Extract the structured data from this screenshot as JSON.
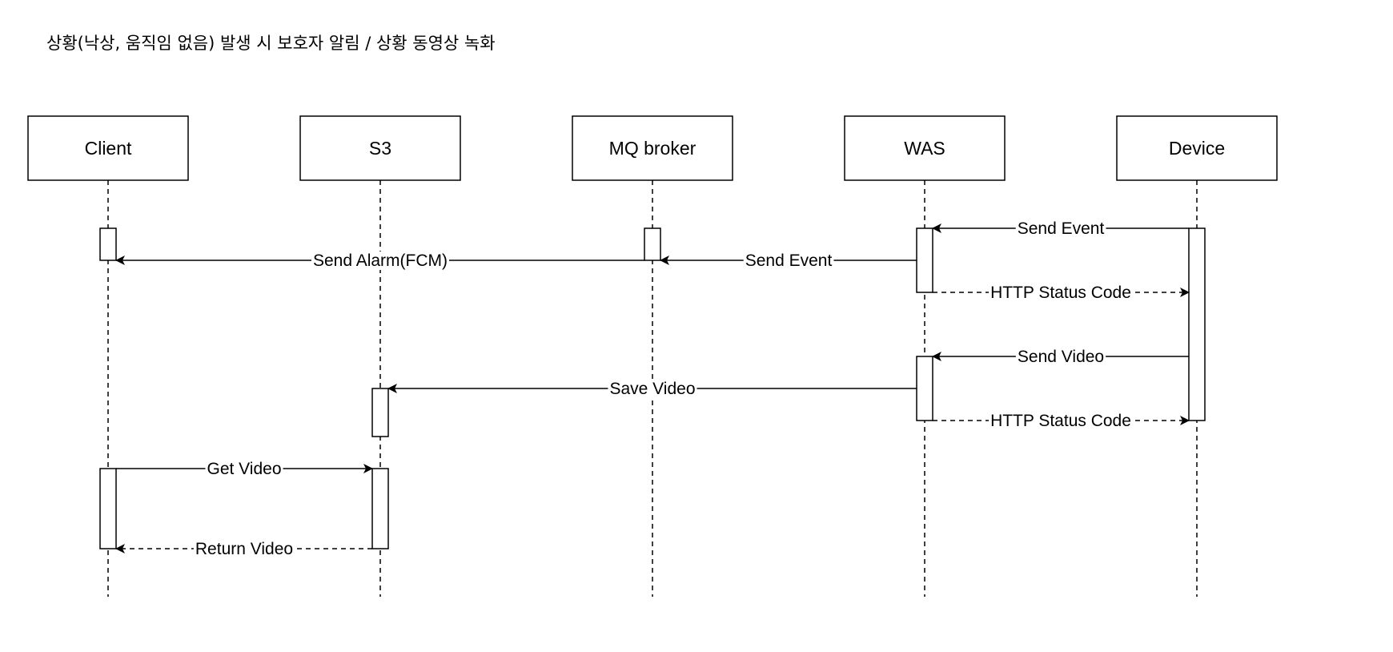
{
  "title": "상황(낙상, 움직임 없음) 발생 시 보호자 알림 / 상황 동영상 녹화",
  "participants": [
    {
      "id": "client",
      "label": "Client"
    },
    {
      "id": "s3",
      "label": "S3"
    },
    {
      "id": "mq",
      "label": "MQ broker"
    },
    {
      "id": "was",
      "label": "WAS"
    },
    {
      "id": "device",
      "label": "Device"
    }
  ],
  "activations": [
    {
      "participant": "client",
      "from_step": 1,
      "to_step": 2
    },
    {
      "participant": "mq",
      "from_step": 1,
      "to_step": 2
    },
    {
      "participant": "was",
      "from_step": 1,
      "to_step": 3
    },
    {
      "participant": "device",
      "from_step": 1,
      "to_step": 6
    },
    {
      "participant": "was",
      "from_step": 4,
      "to_step": 6
    },
    {
      "participant": "s3",
      "from_step": 5,
      "to_step": 6.5
    },
    {
      "participant": "client",
      "from_step": 7,
      "to_step": 8
    },
    {
      "participant": "s3",
      "from_step": 7,
      "to_step": 8
    }
  ],
  "messages": [
    {
      "step": 1,
      "from": "device",
      "to": "was",
      "label": "Send Event",
      "style": "call"
    },
    {
      "step": 2,
      "from": "was",
      "to": "mq",
      "label": "Send Event",
      "style": "call"
    },
    {
      "step": 2,
      "from": "mq",
      "to": "client",
      "label": "Send Alarm(FCM)",
      "style": "call"
    },
    {
      "step": 3,
      "from": "was",
      "to": "device",
      "label": "HTTP Status Code",
      "style": "return"
    },
    {
      "step": 4,
      "from": "device",
      "to": "was",
      "label": "Send Video",
      "style": "call"
    },
    {
      "step": 5,
      "from": "was",
      "to": "s3",
      "label": "Save Video",
      "style": "call"
    },
    {
      "step": 6,
      "from": "was",
      "to": "device",
      "label": "HTTP Status Code",
      "style": "return"
    },
    {
      "step": 7,
      "from": "client",
      "to": "s3",
      "label": "Get Video",
      "style": "call"
    },
    {
      "step": 8,
      "from": "s3",
      "to": "client",
      "label": "Return Video",
      "style": "return"
    }
  ]
}
